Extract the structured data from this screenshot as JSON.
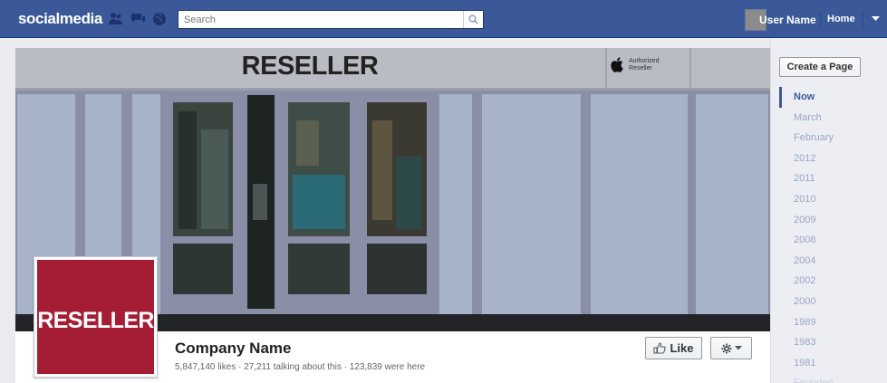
{
  "topbar": {
    "brand": "socialmedia",
    "search_placeholder": "Search",
    "user_name": "User Name",
    "home_label": "Home"
  },
  "cover": {
    "sign_text": "RESELLER",
    "badge_line1": "Authorized",
    "badge_line2": "Reseller"
  },
  "profile": {
    "picture_text": "RESELLER",
    "company_name": "Company Name",
    "stats": "5,847,140 likes · 27,211 talking about this · 123,839 were here",
    "like_label": "Like"
  },
  "sidebar": {
    "create_page_label": "Create a Page",
    "timeline": [
      {
        "label": "Now"
      },
      {
        "label": "March"
      },
      {
        "label": "February"
      },
      {
        "label": "2012"
      },
      {
        "label": "2011"
      },
      {
        "label": "2010"
      },
      {
        "label": "2009"
      },
      {
        "label": "2008"
      },
      {
        "label": "2004"
      },
      {
        "label": "2002"
      },
      {
        "label": "2000"
      },
      {
        "label": "1989"
      },
      {
        "label": "1983"
      },
      {
        "label": "1981"
      },
      {
        "label": "Founded"
      }
    ]
  },
  "colors": {
    "topbar": "#3b5998",
    "profile_red": "#a51d34",
    "link_blue": "#3b5998"
  },
  "icons": [
    "friends-icon",
    "messages-icon",
    "notifications-icon",
    "search-icon",
    "dropdown-arrow-icon",
    "thumbs-up-icon",
    "gear-icon",
    "apple-icon"
  ]
}
